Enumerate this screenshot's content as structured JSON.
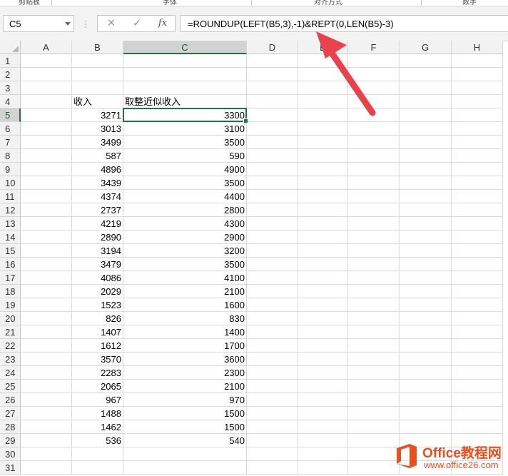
{
  "ribbon_groups": [
    "剪贴板",
    "字体",
    "对齐方式",
    "数字"
  ],
  "formula_bar": {
    "name_box": "C5",
    "cancel_glyph": "✕",
    "enter_glyph": "✓",
    "fx_label": "fx",
    "formula": "=ROUNDUP(LEFT(B5,3),-1)&REPT(0,LEN(B5)-3)"
  },
  "grid": {
    "columns": [
      "A",
      "B",
      "C",
      "D",
      "E",
      "F",
      "G",
      "H"
    ],
    "active_column": "C",
    "active_row": 5,
    "rows": [
      "1",
      "2",
      "3",
      "4",
      "5",
      "6",
      "7",
      "8",
      "9",
      "10",
      "11",
      "12",
      "13",
      "14",
      "15",
      "16",
      "17",
      "18",
      "19",
      "20",
      "21",
      "22",
      "23",
      "24",
      "25",
      "26",
      "27",
      "28",
      "29",
      "30",
      "31"
    ],
    "header_row": {
      "row": 4,
      "b": "收入",
      "c": "取整近似收入"
    },
    "data": [
      {
        "b": "3271",
        "c": "3300"
      },
      {
        "b": "3013",
        "c": "3100"
      },
      {
        "b": "3499",
        "c": "3500"
      },
      {
        "b": "587",
        "c": "590"
      },
      {
        "b": "4896",
        "c": "4900"
      },
      {
        "b": "3439",
        "c": "3500"
      },
      {
        "b": "4374",
        "c": "4400"
      },
      {
        "b": "2737",
        "c": "2800"
      },
      {
        "b": "4219",
        "c": "4300"
      },
      {
        "b": "2890",
        "c": "2900"
      },
      {
        "b": "3194",
        "c": "3200"
      },
      {
        "b": "3479",
        "c": "3500"
      },
      {
        "b": "4086",
        "c": "4100"
      },
      {
        "b": "2029",
        "c": "2100"
      },
      {
        "b": "1523",
        "c": "1600"
      },
      {
        "b": "826",
        "c": "830"
      },
      {
        "b": "1407",
        "c": "1400"
      },
      {
        "b": "1612",
        "c": "1700"
      },
      {
        "b": "3570",
        "c": "3600"
      },
      {
        "b": "2283",
        "c": "2300"
      },
      {
        "b": "2065",
        "c": "2100"
      },
      {
        "b": "967",
        "c": "970"
      },
      {
        "b": "1488",
        "c": "1500"
      },
      {
        "b": "1462",
        "c": "1500"
      },
      {
        "b": "536",
        "c": "540"
      }
    ]
  },
  "annotation": {
    "arrow_color": "#e8424d"
  },
  "watermark": {
    "title": "Office教程网",
    "url": "www.office26.com",
    "brand_color": "#e8501f"
  }
}
